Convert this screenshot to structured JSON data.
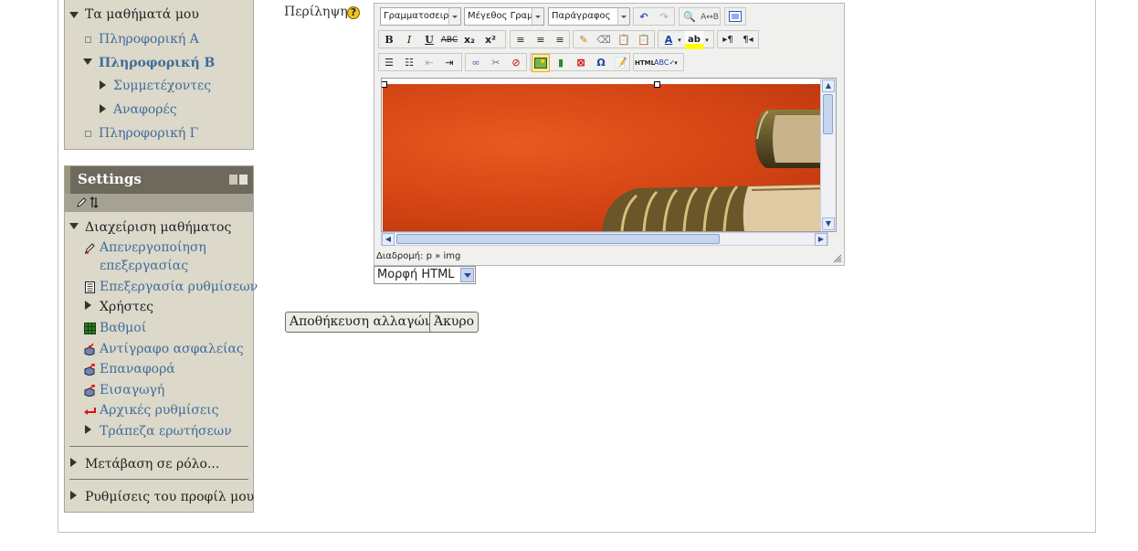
{
  "nav": {
    "my_courses": "Τα μαθήματά μου",
    "courses": [
      {
        "label": "Πληροφορική Α"
      },
      {
        "label": "Πληροφορική Β"
      },
      {
        "label": "Συμμετέχοντες"
      },
      {
        "label": "Αναφορές"
      },
      {
        "label": "Πληροφορική Γ"
      }
    ]
  },
  "settings": {
    "title": "Settings",
    "course_admin": "Διαχείριση μαθήματος",
    "items": [
      {
        "label": "Απενεργοποίηση επεξεργασίας",
        "line1": "Απενεργοποίηση",
        "line2": "επεξεργασίας",
        "icon": "pencil-icon"
      },
      {
        "label": "Επεξεργασία ρυθμίσεων",
        "icon": "settings-doc-icon"
      },
      {
        "label": "Χρήστες",
        "icon": "expand-icon"
      },
      {
        "label": "Βαθμοί",
        "icon": "grades-icon"
      },
      {
        "label": "Αντίγραφο ασφαλείας",
        "icon": "backup-icon"
      },
      {
        "label": "Επαναφορά",
        "icon": "restore-icon"
      },
      {
        "label": "Εισαγωγή",
        "icon": "import-icon"
      },
      {
        "label": "Αρχικές ρυθμίσεις",
        "icon": "reset-icon"
      },
      {
        "label": "Τράπεζα ερωτήσεων",
        "icon": "expand-icon"
      }
    ],
    "switch_role": "Μετάβαση σε ρόλο...",
    "profile_settings": "Ρυθμίσεις του προφίλ μου"
  },
  "form": {
    "summary_label": "Περίληψη",
    "editor": {
      "font_family_placeholder": "Γραμματοσειρά",
      "font_size_placeholder": "Μέγεθος Γραμματοσειράς",
      "format_placeholder": "Παράγραφος",
      "path_label": "Διαδρομή: p » img"
    },
    "format_value": "Μορφή HTML",
    "save_label": "Αποθήκευση αλλαγών",
    "cancel_label": "Άκυρο"
  },
  "colors": {
    "block_bg": "#dcd8ca",
    "settings_header": "#6d6a5d",
    "link": "#3f6d9a",
    "image_orange": "#d04212"
  }
}
